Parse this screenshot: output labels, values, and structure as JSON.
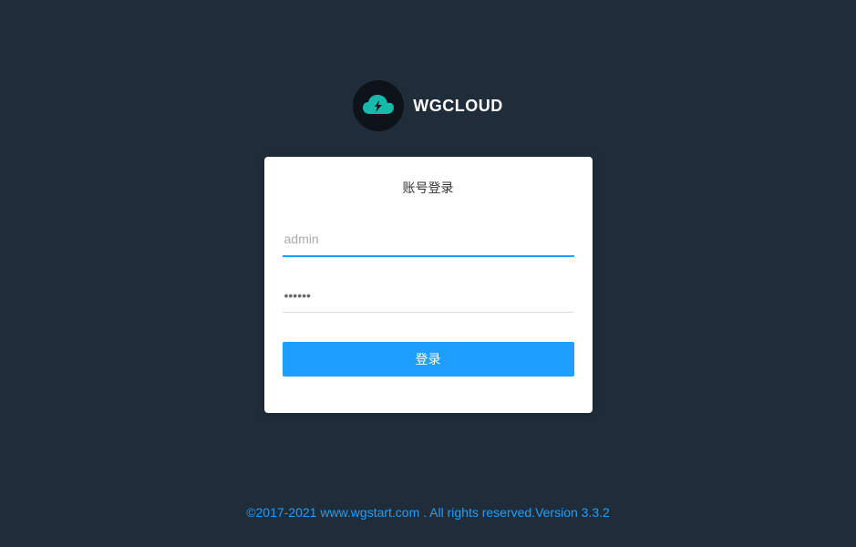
{
  "brand": {
    "name": "WGCLOUD"
  },
  "login": {
    "title": "账号登录",
    "username_placeholder": "admin",
    "username_value": "",
    "password_value": "••••••",
    "submit_label": "登录"
  },
  "footer": {
    "text": "©2017-2021 www.wgstart.com . All rights reserved.Version 3.3.2"
  }
}
